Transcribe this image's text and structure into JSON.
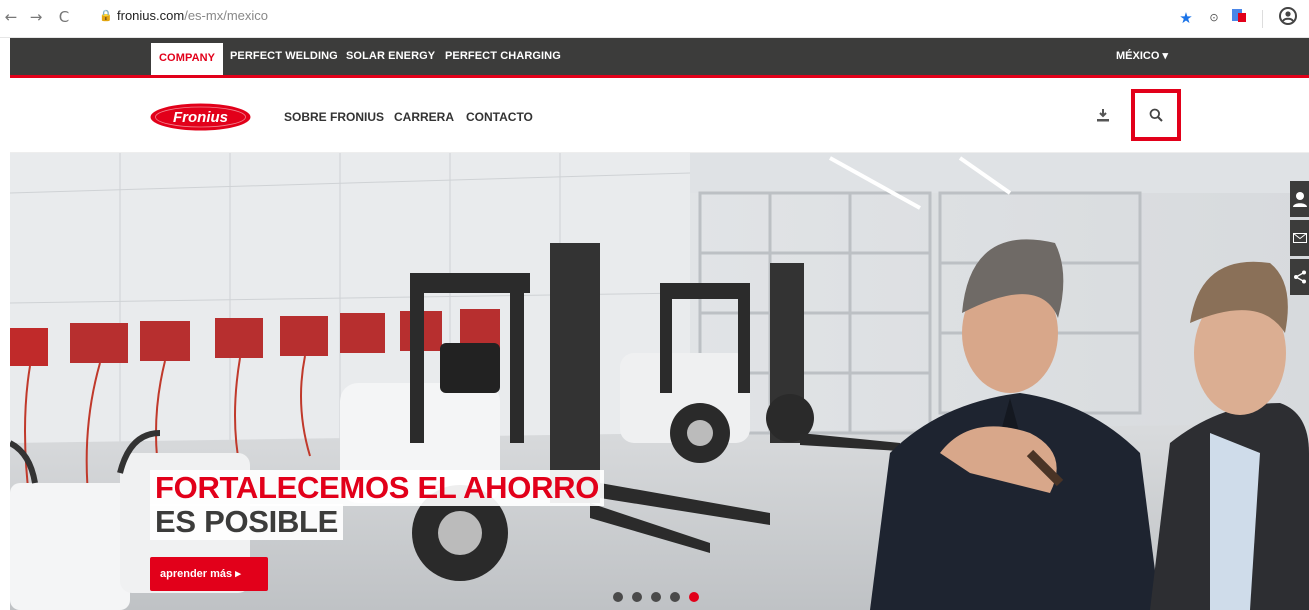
{
  "browser": {
    "url_domain": "fronius.com",
    "url_path": "/es-mx/mexico"
  },
  "topnav": {
    "items": [
      "COMPANY",
      "PERFECT WELDING",
      "SOLAR ENERGY",
      "PERFECT CHARGING"
    ],
    "active_index": 0,
    "country": "MÉXICO ▾"
  },
  "header": {
    "logo_text": "Fronius",
    "nav": [
      "SOBRE FRONIUS",
      "CARRERA",
      "CONTACTO"
    ]
  },
  "hero": {
    "headline_line1": "FORTALECEMOS EL AHORRO",
    "headline_line2": "ES POSIBLE",
    "cta_label": "aprender más ▸",
    "slides_total": 5,
    "slide_active": 5
  },
  "colors": {
    "brand_red": "#e2001a",
    "nav_dark": "#3c3c3b"
  },
  "icons": [
    "back-icon",
    "forward-icon",
    "reload-icon",
    "lock-icon",
    "star-icon",
    "extension-icon",
    "profile-icon",
    "download-icon",
    "search-icon",
    "contact-person-icon",
    "mail-icon",
    "share-icon"
  ]
}
